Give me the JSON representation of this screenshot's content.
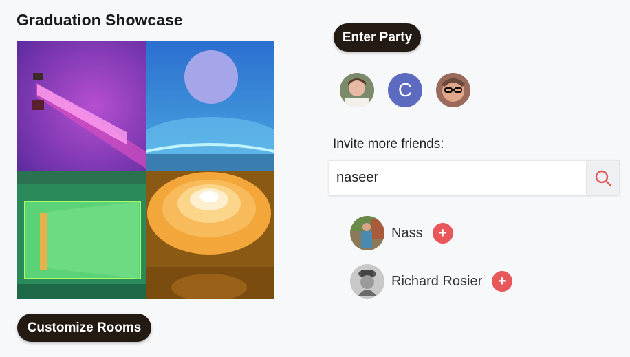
{
  "page": {
    "title": "Graduation Showcase"
  },
  "actions": {
    "enter_party": "Enter Party",
    "customize_rooms": "Customize Rooms"
  },
  "party_members": [
    {
      "type": "photo",
      "icon": "person-photo"
    },
    {
      "type": "letter",
      "letter": "C",
      "color": "#5c6bc0"
    },
    {
      "type": "photo",
      "icon": "person-photo"
    }
  ],
  "invite": {
    "label": "Invite more friends:",
    "search_value": "naseer",
    "search_icon": "search-icon"
  },
  "results": [
    {
      "name": "Nass",
      "add_label": "+"
    },
    {
      "name": "Richard Rosier",
      "add_label": "+"
    }
  ],
  "colors": {
    "pill_bg": "#231a14",
    "add_button": "#e8585a",
    "search_icon": "#e05a5a"
  }
}
